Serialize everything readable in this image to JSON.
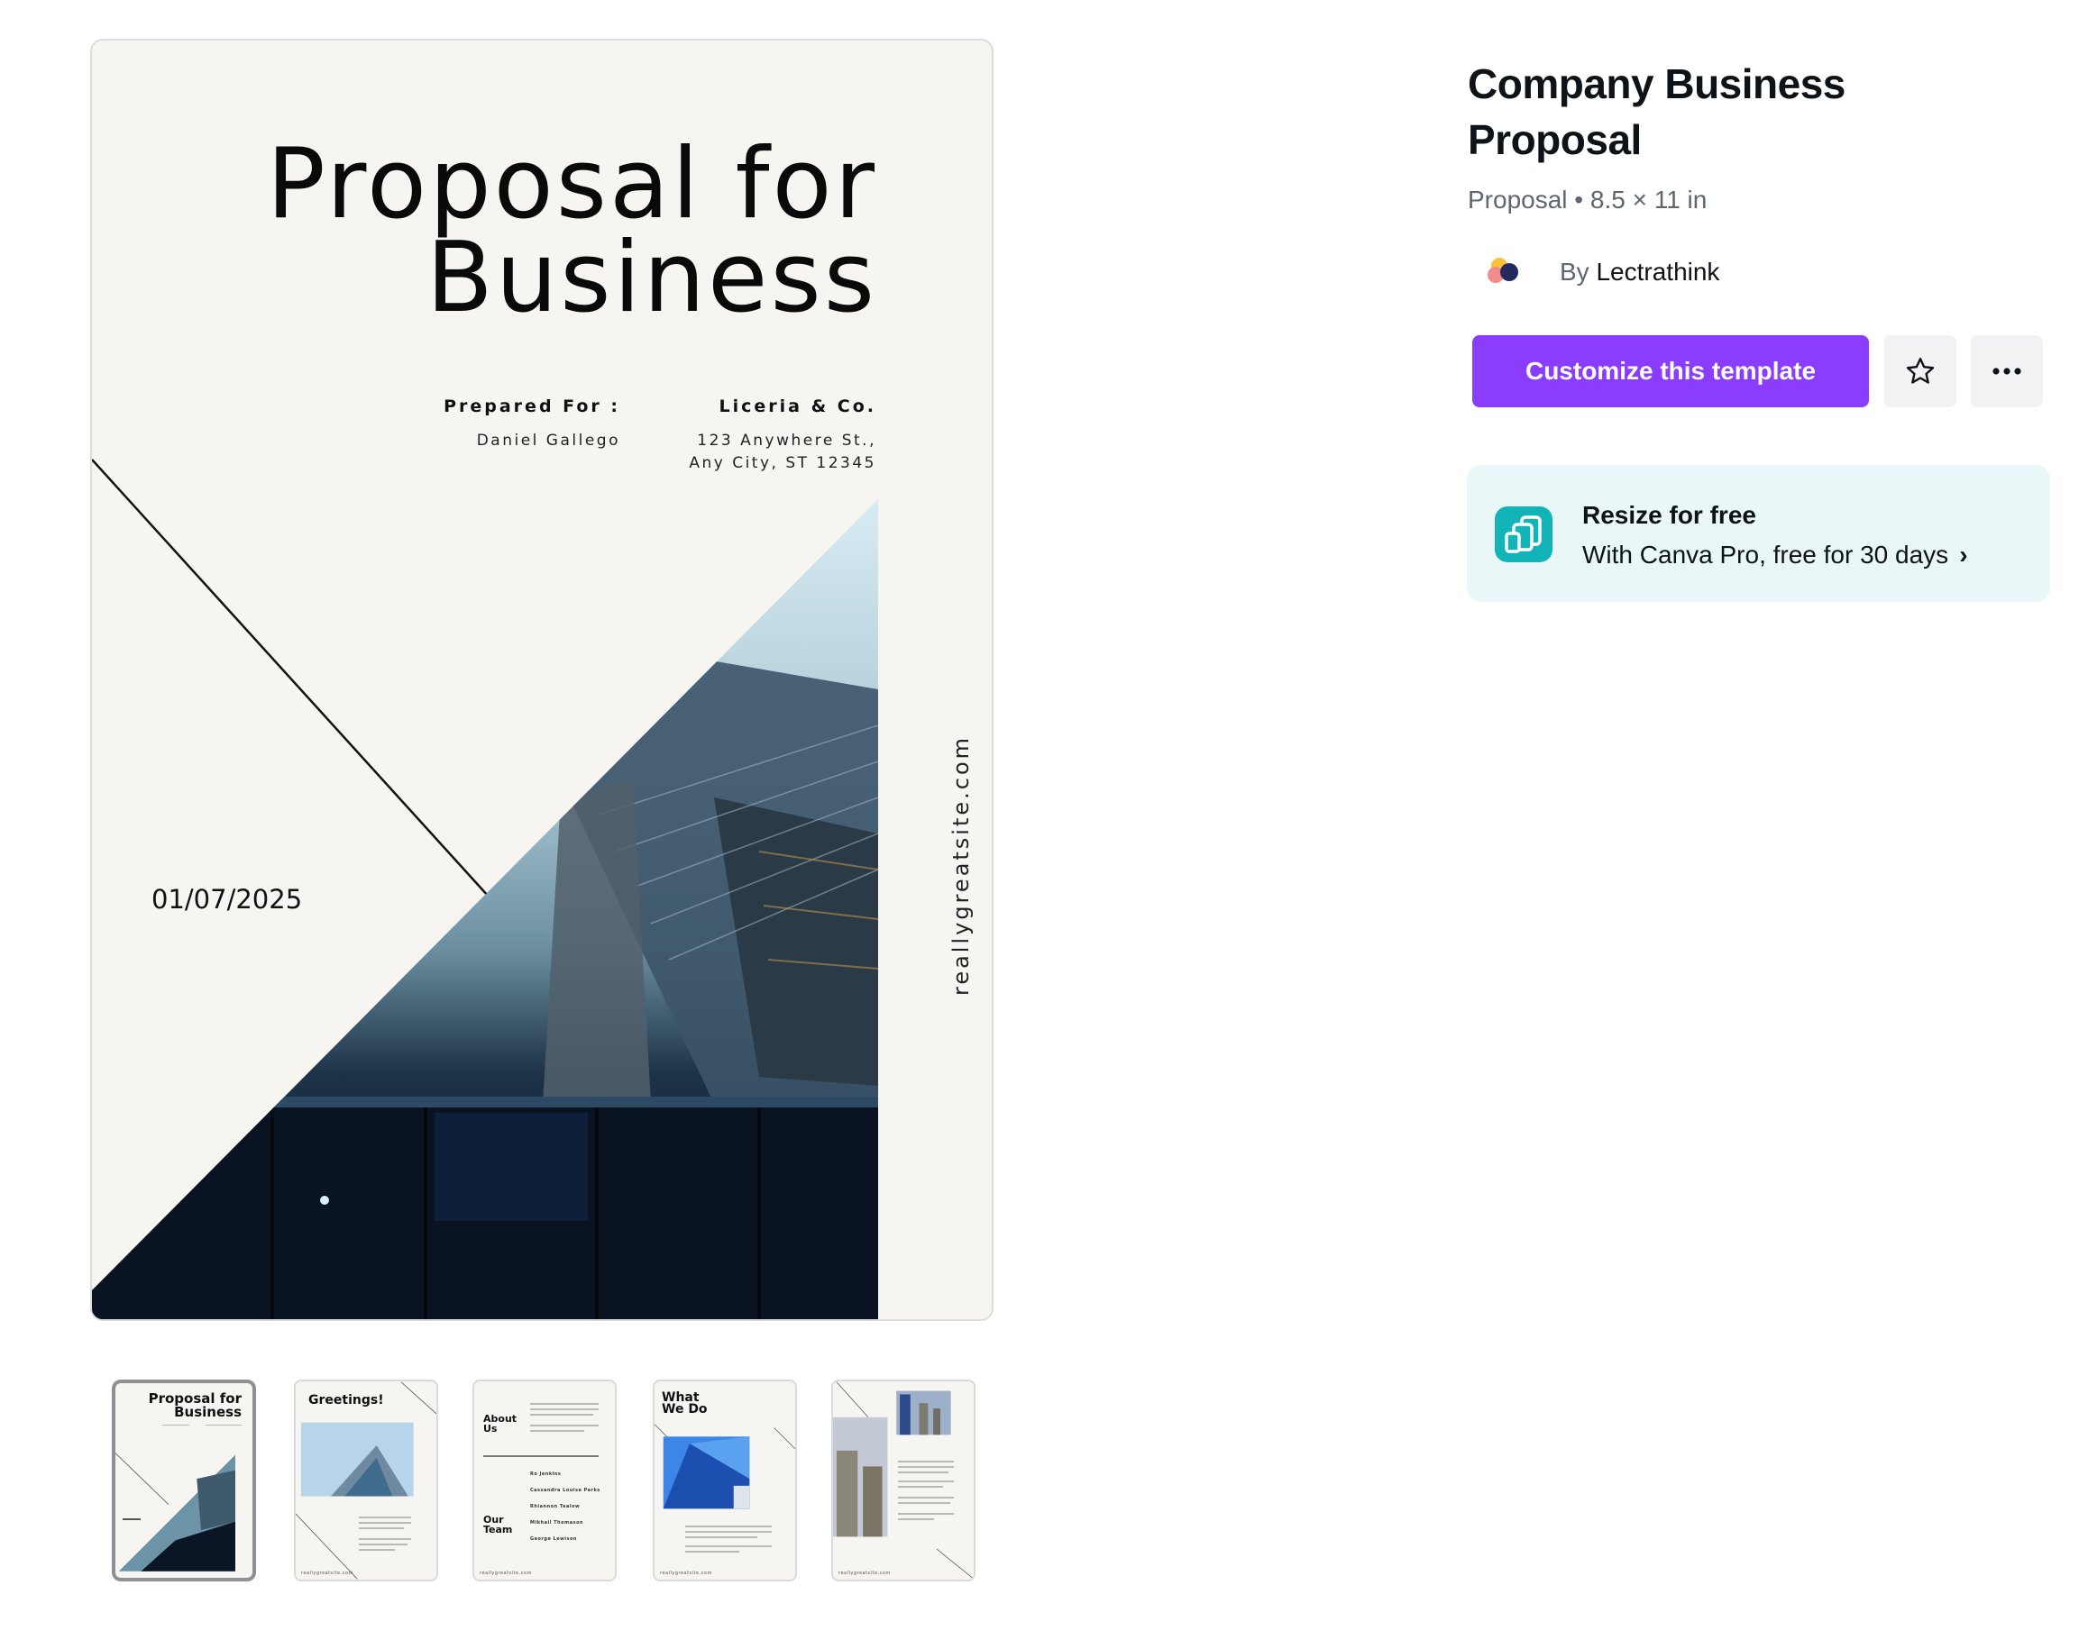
{
  "template": {
    "title": "Company Business Proposal",
    "meta": "Proposal • 8.5 × 11 in",
    "author_prefix": "By",
    "author_name": "Lectrathink",
    "customize_label": "Customize this template",
    "favorite_icon": "star-icon",
    "more_icon": "more-horizontal-icon"
  },
  "promo": {
    "icon": "resize-icon",
    "heading": "Resize for free",
    "subtext": "With Canva Pro, free for 30 days",
    "chevron": "›"
  },
  "colors": {
    "primary": "#8b3dff",
    "promo_bg": "#eaf7f8",
    "promo_icon": "#13b4b7",
    "page_bg": "#f6f5f2"
  },
  "preview": {
    "title_line1": "Proposal for",
    "title_line2": "Business",
    "prepared_for_label": "Prepared For :",
    "prepared_for_name": "Daniel Gallego",
    "company_name": "Liceria & Co.",
    "address_line1": "123 Anywhere St.,",
    "address_line2": "Any City, ST 12345",
    "date": "01/07/2025",
    "website": "reallygreatsite.com"
  },
  "thumbnails": [
    {
      "page": 1,
      "heading": "Proposal for Business",
      "selected": true
    },
    {
      "page": 2,
      "heading": "Greetings!",
      "selected": false
    },
    {
      "page": 3,
      "heading": "About Us",
      "heading2": "Our Team",
      "selected": false,
      "team": [
        "Ro Jenkins",
        "Cassandra Louise Parks",
        "Rhiannon Tealow",
        "Mikhail Thomason",
        "George Lewison"
      ]
    },
    {
      "page": 4,
      "heading": "What We Do",
      "selected": false
    },
    {
      "page": 5,
      "heading": "",
      "selected": false
    }
  ],
  "thumb_footer": "reallygreatsite.com"
}
